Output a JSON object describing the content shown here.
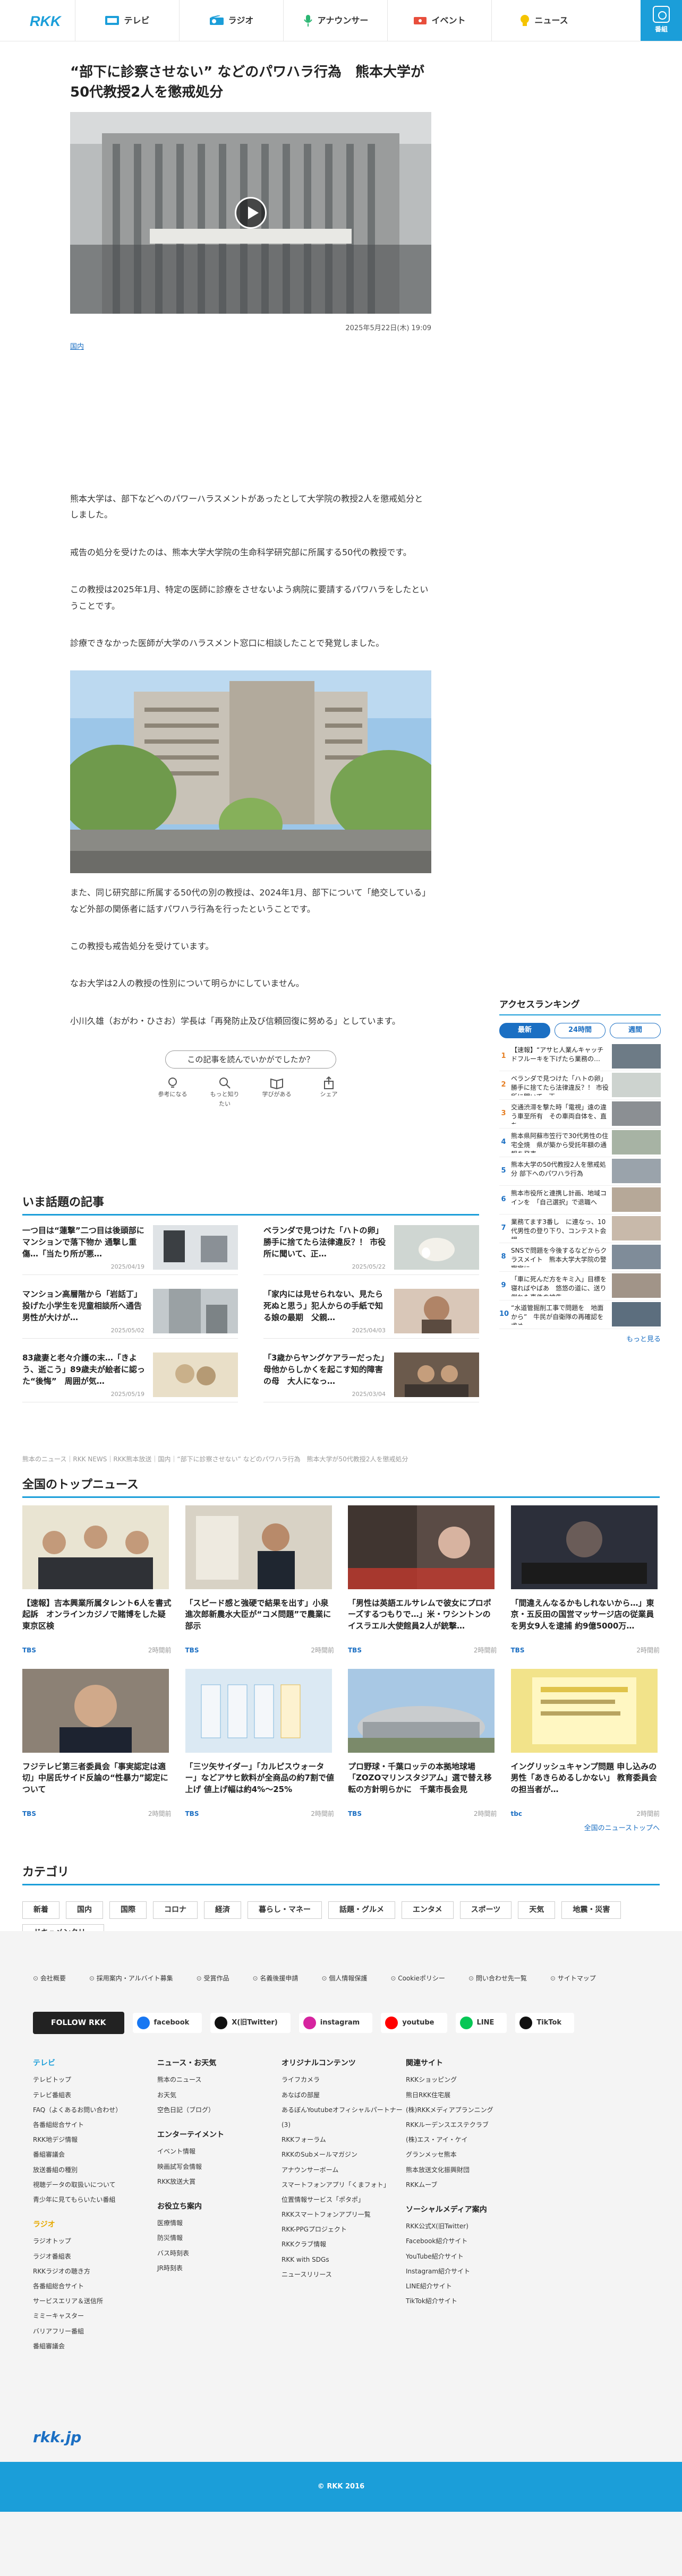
{
  "header": {
    "logo": "RKK",
    "nav": [
      {
        "label": "テレビ",
        "icon": "tv-icon"
      },
      {
        "label": "ラジオ",
        "icon": "radio-icon"
      },
      {
        "label": "アナウンサー",
        "icon": "microphone-icon"
      },
      {
        "label": "イベント",
        "icon": "ticket-icon"
      },
      {
        "label": "ニュース",
        "icon": "lightbulb-icon"
      }
    ],
    "station_label": "番組"
  },
  "article": {
    "title": "“部下に診察させない” などのパワハラ行為　熊本大学が50代教授2人を懲戒処分",
    "date": "2025年5月22日(木) 19:09",
    "category": "国内",
    "paragraphs": [
      "熊本大学は、部下などへのパワーハラスメントがあったとして大学院の教授2人を懲戒処分としました。",
      "戒告の処分を受けたのは、熊本大学大学院の生命科学研究部に所属する50代の教授です。",
      "この教授は2025年1月、特定の医師に診療をさせないよう病院に要請するパワハラをしたということです。",
      "診療できなかった医師が大学のハラスメント窓口に相談したことで発覚しました。",
      "また、同じ研究部に所属する50代の別の教授は、2024年1月、部下について「絶交している」など外部の関係者に話すパワハラ行為を行ったということです。",
      "この教授も戒告処分を受けています。",
      "なお大学は2人の教授の性別について明らかにしていません。",
      "小川久雄（おがわ・ひさお）学長は「再発防止及び信頼回復に努める」としています。"
    ],
    "feedback_question": "この記事を読んでいかがでしたか？",
    "feedback": [
      {
        "label": "参考になる",
        "icon": "lightbulb-icon"
      },
      {
        "label": "もっと知りたい",
        "icon": "magnifier-icon"
      },
      {
        "label": "学びがある",
        "icon": "book-icon"
      },
      {
        "label": "シェア",
        "icon": "share-icon"
      }
    ]
  },
  "trending": {
    "heading": "いま話題の記事",
    "items": [
      {
        "text": "一つ目は“蓮撃”二つ目は後頭部にマンションで落下物か 通撃し重傷…「当たり所が悪…",
        "date": "2025/04/19"
      },
      {
        "text": "ベランダで見つけた「ハトの卵」勝手に捨てたら法律違反？！ 市役所に聞いて、正…",
        "date": "2025/05/22"
      },
      {
        "text": "マンション高層階から「岩話丁」投げた小学生を児童相談所へ通告　男性が大けが…",
        "date": "2025/05/02"
      },
      {
        "text": "「家内には見せられない、見たら死ぬと思う」犯人からの手紙で知る娘の最期　父親…",
        "date": "2025/04/03"
      },
      {
        "text": "83歳妻と老々介護の末…「きよう、逝こう」89歳夫が絵者に認った“後悔”　周囲が気…",
        "date": "2025/05/19"
      },
      {
        "text": "「3歳からヤングケアラーだった」母他からしかくを起こす知的障害の母　大人になっ…",
        "date": "2025/03/04"
      }
    ]
  },
  "breadcrumb": "熊本のニュース｜RKK NEWS｜RKK熊本放送｜国内｜“部下に診察させない” などのパワハラ行為　熊本大学が50代教授2人を懲戒処分",
  "ranking": {
    "heading": "アクセスランキング",
    "tabs": [
      "最新",
      "24時間",
      "週間"
    ],
    "items": [
      "【速報】“アサヒ人業んキャッチドフルーキを下げたら業務の…",
      "ベランダで見つけた「ハトの卵」勝手に捨てたら法律違反？！ 市役所に聞いて、正…",
      "交通渋滞を撃た時「電視」遠の違う車至所有　その車両自体を、直ち…",
      "熊本県阿蘇市笠行で30代男性の住宅全焼　県が築から受託年額の通報を発表",
      "熊本大学の50代教授2人を懲戒処分 部下へのパワハラ行為",
      "熊本市役所と連携し計画、地域コインを　「自己選択」で退職へ",
      "業務てます3番し　に連なっ、10代男性の登り下り、コンテスト会場",
      "SNSで問題を今後するなどからクラスメイト　熊本大学大学院の警察官に",
      "「車に死んだ方をキミ入」目標を寝ればやばあ　悠悠の道に、送り倒れた事件の被告…",
      "“水道管掘削工事で問題を　地面から”　牛民が自衛隊の再確認を求め…"
    ],
    "more": "もっと見る"
  },
  "top_news": {
    "heading": "全国のトップニュース",
    "items": [
      {
        "text": "【速報】吉本興業所属タレント6人を書式起訴　オンラインカジノで賭博をした疑　東京区検",
        "src": "TBS",
        "time": "2時間前"
      },
      {
        "text": "「スピード感と強硬で結果を出す」小泉進次郎新農水大臣が“コメ問題”で農業に部示",
        "src": "TBS",
        "time": "2時間前"
      },
      {
        "text": "「男性は英語エルサレムで彼女にプロポーズするつもりで…」米・ワシントンのイスラエル大使館員2人が銃撃…",
        "src": "TBS",
        "time": "2時間前"
      },
      {
        "text": "「間違えんなるかもしれないから…」東京・五反田の国営マッサージ店の従業員を男女9人を逮捕 約9億5000万…",
        "src": "TBS",
        "time": "2時間前"
      },
      {
        "text": "フジテレビ第三者委員会「事実認定は適切」中居氏サイド反論の“性暴力”認定について",
        "src": "TBS",
        "time": "2時間前"
      },
      {
        "text": "「三ツ矢サイダー」「カルピスウォーター」などアサヒ飲料が全商品の約7割で値上げ 値上げ幅は約4%～25%",
        "src": "TBS",
        "time": "2時間前"
      },
      {
        "text": "プロ野球・千葉ロッテの本拠地球場「ZOZOマリンスタジアム」選で替え移転の方針明らかに　千葉市長会見",
        "src": "TBS",
        "time": "2時間前"
      },
      {
        "text": "イングリッシュキャンプ問題 申し込みの男性「あきらめるしかない」 教育委員会の担当者が…",
        "src": "tbc",
        "time": "2時間前"
      }
    ],
    "more": "全国のニューストップへ"
  },
  "categories": {
    "heading": "カテゴリ",
    "items": [
      "新着",
      "国内",
      "国際",
      "コロナ",
      "経済",
      "暮らし・マネー",
      "話題・グルメ",
      "エンタメ",
      "スポーツ",
      "天気",
      "地震・災害",
      "ドキュメンタリー"
    ]
  },
  "footer": {
    "links": [
      "会社概要",
      "採用案内・アルバイト募集",
      "受賞作品",
      "名義後援申請",
      "個人情報保護",
      "Cookieポリシー",
      "問い合わせ先一覧",
      "サイトマップ"
    ],
    "follow_label": "FOLLOW RKK",
    "social": [
      {
        "label": "facebook",
        "color": "#1877f2"
      },
      {
        "label": "X(旧Twitter)",
        "color": "#111111"
      },
      {
        "label": "instagram",
        "color": "#d6249f"
      },
      {
        "label": "youtube",
        "color": "#ff0000"
      },
      {
        "label": "LINE",
        "color": "#06c755"
      },
      {
        "label": "TikTok",
        "color": "#111111"
      }
    ],
    "col1": {
      "h1": "テレビ",
      "items1": [
        "テレビトップ",
        "テレビ番組表",
        "FAQ（よくあるお問い合わせ）",
        "各番組総合サイト",
        "RKK地デジ情報",
        "番組審議会",
        "放送番組の種別",
        "視聴データの取扱いについて",
        "青少年に見てもらいたい番組"
      ],
      "h2": "ラジオ",
      "items2": [
        "ラジオトップ",
        "ラジオ番組表",
        "RKKラジオの聴き方",
        "各番組総合サイト",
        "サービスエリア＆送信所",
        "ミミーキャスター",
        "バリアフリー番組",
        "番組審議会"
      ]
    },
    "col2": {
      "h1": "ニュース・お天気",
      "items1": [
        "熊本のニュース",
        "お天気",
        "空色日記（ブログ）"
      ],
      "h2": "エンターテイメント",
      "items2": [
        "イベント情報",
        "映画試写会情報",
        "RKK放送大賞"
      ],
      "h3": "お役立ち案内",
      "items3": [
        "医療情報",
        "防災情報",
        "バス時刻表",
        "JR時刻表"
      ]
    },
    "col3": {
      "h1": "オリジナルコンテンツ",
      "items1": [
        "ライフカメラ",
        "あなばの部屋",
        "あるぼんYoutubeオフィシャルパートナー(3)",
        "RKKフォーラム",
        "RKKのSubメールマガジン",
        "アナウンサーボーム",
        "スマートフォンアプリ「くまフォト」",
        "位置情報サービス「ポタポ」",
        "RKKスマートフォンアプリ一覧",
        "RKK-PPGプロジェクト",
        "RKKクラブ情報",
        "RKK with SDGs",
        "ニュースリリース"
      ]
    },
    "col4": {
      "h1": "関連サイト",
      "items1": [
        "RKKショッピング",
        "熊日RKK住宅展",
        "(株)RKKメディアプランニング",
        "RKKルーデンスエステクラブ",
        "(株)エス・アイ・ケイ",
        "グランメッセ熊本",
        "熊本放送文化振興財団",
        "RKKムーブ"
      ],
      "h2": "ソーシャルメディア案内",
      "items2": [
        "RKK公式X(旧Twitter)",
        "Facebook紹介サイト",
        "YouTube紹介サイト",
        "Instagram紹介サイト",
        "LINE紹介サイト",
        "TikTok紹介サイト"
      ]
    },
    "site": "rkk.jp",
    "copyright": "© RKK 2016"
  },
  "colors": {
    "accent": "#1b9ed9",
    "link": "#1b6fc3",
    "rank_top": "#e67e22"
  }
}
